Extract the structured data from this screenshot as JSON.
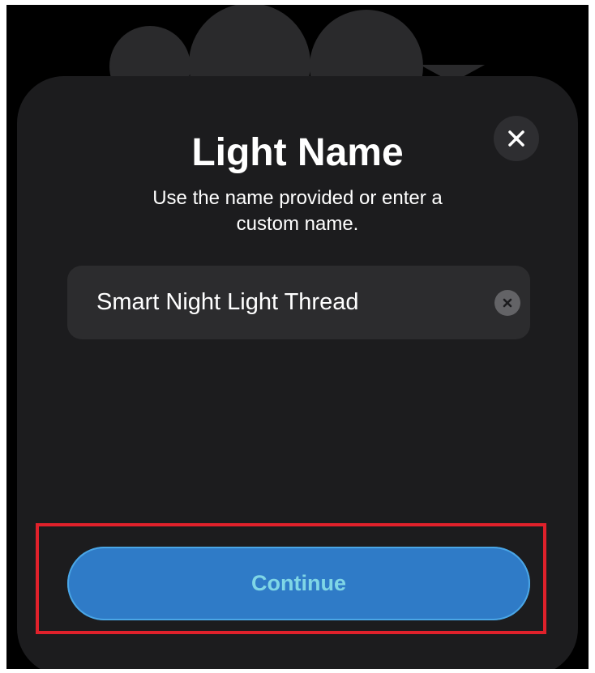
{
  "dialog": {
    "title": "Light Name",
    "subtitle_line1": "Use the name provided or enter a",
    "subtitle_line2": "custom name."
  },
  "name_field": {
    "value": "Smart Night Light Thread",
    "placeholder": ""
  },
  "actions": {
    "continue_label": "Continue"
  },
  "icons": {
    "close": "close-icon",
    "clear": "clear-text-icon"
  },
  "colors": {
    "sheet_background": "#1c1c1e",
    "field_background": "#2c2c2e",
    "continue_background": "#2f7bc7",
    "continue_text": "#7fd6e6",
    "highlight": "#e0212b"
  }
}
